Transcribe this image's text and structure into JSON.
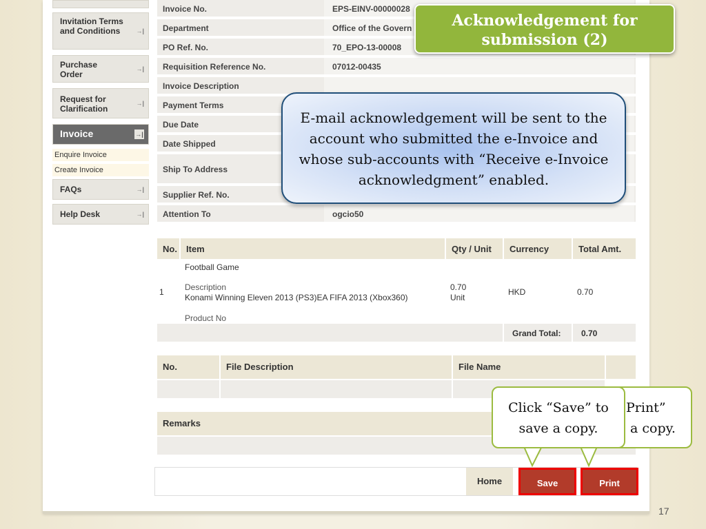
{
  "sidebar": {
    "items": [
      {
        "label": "Invitation Terms and Conditions"
      },
      {
        "label": "Purchase Order"
      },
      {
        "label": "Request for Clarification"
      },
      {
        "label": "Invoice"
      },
      {
        "label": "FAQs"
      },
      {
        "label": "Help Desk"
      }
    ],
    "subitems": [
      {
        "label": "Enquire Invoice"
      },
      {
        "label": "Create Invoice"
      }
    ]
  },
  "details": [
    {
      "label": "Invoice No.",
      "value": "EPS-EINV-00000028"
    },
    {
      "label": "Department",
      "value": "Office of the Govern"
    },
    {
      "label": "PO Ref. No.",
      "value": "70_EPO-13-00008"
    },
    {
      "label": "Requisition Reference No.",
      "value": "07012-00435"
    },
    {
      "label": "Invoice Description",
      "value": ""
    },
    {
      "label": "Payment Terms",
      "value": ""
    },
    {
      "label": "Due Date",
      "value": ""
    },
    {
      "label": "Date Shipped",
      "value": ""
    },
    {
      "label": "Ship To Address",
      "value": ""
    },
    {
      "label": "Supplier Ref. No.",
      "value": ""
    },
    {
      "label": "Attention To",
      "value": "ogcio50"
    }
  ],
  "items_table": {
    "headers": [
      "No.",
      "Item",
      "Qty / Unit",
      "Currency",
      "Total Amt."
    ],
    "row": {
      "no": "1",
      "item_name": "Football Game",
      "desc_label": "Description",
      "desc_value": "Konami Winning Eleven 2013 (PS3)EA FIFA 2013 (Xbox360)",
      "product_label": "Product No",
      "qty": "0.70",
      "unit": "Unit",
      "currency": "HKD",
      "total": "0.70"
    },
    "grand_total_label": "Grand Total:",
    "grand_total_value": "0.70"
  },
  "files_table": {
    "headers": [
      "No.",
      "File Description",
      "File Name"
    ]
  },
  "remarks_label": "Remarks",
  "buttons": {
    "home": "Home",
    "save": "Save",
    "print": "Print"
  },
  "callouts": {
    "title": "Acknowledgement for submission (2)",
    "info": "E-mail acknowledgement will be sent to the account who submitted the e-Invoice and whose sub-accounts with “Receive e-Invoice acknowledgment” enabled.",
    "save_hint": "Click “Save” to save a copy.",
    "print_hint_1": "Print”",
    "print_hint_2": "a copy."
  },
  "slide_number": "17",
  "colors": {
    "accent_green": "#92b63c",
    "button_red": "#b23b2a",
    "highlight_red": "#e00000"
  }
}
